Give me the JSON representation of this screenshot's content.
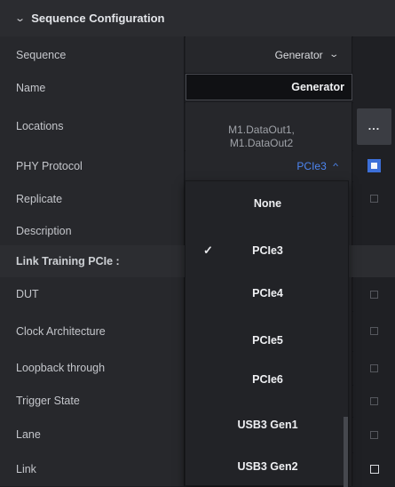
{
  "header": {
    "title": "Sequence Configuration"
  },
  "rows": {
    "sequence": {
      "label": "Sequence",
      "value": "Generator"
    },
    "name": {
      "label": "Name",
      "value": "Generator"
    },
    "locations": {
      "label": "Locations",
      "value_line1": "M1.DataOut1,",
      "value_line2": "M1.DataOut2",
      "button": "..."
    },
    "phy": {
      "label": "PHY Protocol",
      "value": "PCIe3"
    },
    "replicate": {
      "label": "Replicate"
    },
    "description": {
      "label": "Description"
    },
    "section": {
      "label": "Link Training PCIe :"
    },
    "dut": {
      "label": "DUT"
    },
    "clock": {
      "label": "Clock Architecture"
    },
    "loopback": {
      "label": "Loopback through"
    },
    "trigger": {
      "label": "Trigger State"
    },
    "lane": {
      "label": "Lane"
    },
    "link": {
      "label": "Link"
    }
  },
  "dropdown": {
    "selected": "PCIe3",
    "options": [
      "None",
      "PCIe3",
      "PCIe4",
      "PCIe5",
      "PCIe6",
      "USB3 Gen1",
      "USB3 Gen2"
    ]
  },
  "icons": {
    "header_chevron": "chevron-down-icon",
    "sequence_chevron": "chevron-down-icon",
    "phy_chevron": "chevron-up-icon",
    "check": "checkmark-icon"
  },
  "colors": {
    "accent": "#4d86f2",
    "toggle": "#3c6fd8"
  }
}
